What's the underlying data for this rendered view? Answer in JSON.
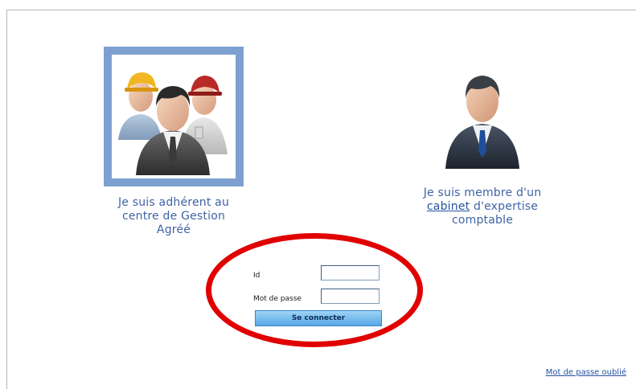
{
  "choices": {
    "adherent": {
      "line1": "Je suis adhérent au",
      "line2": "centre de Gestion",
      "line3": "Agréé",
      "selected": true
    },
    "membre": {
      "line1": "Je suis membre d'un",
      "link": "cabinet",
      "line2_rest": " d'expertise",
      "line3": "comptable"
    }
  },
  "login": {
    "id_label": "Id",
    "id_value": "",
    "password_label": "Mot de passe",
    "password_value": "",
    "button_label": "Se connecter"
  },
  "footer": {
    "link_label": "Mot de passe oublié"
  },
  "colors": {
    "selection_frame": "#7da0d1",
    "label_text": "#3f63a6",
    "annotation": "#e00000",
    "button": "#56a8e6"
  }
}
